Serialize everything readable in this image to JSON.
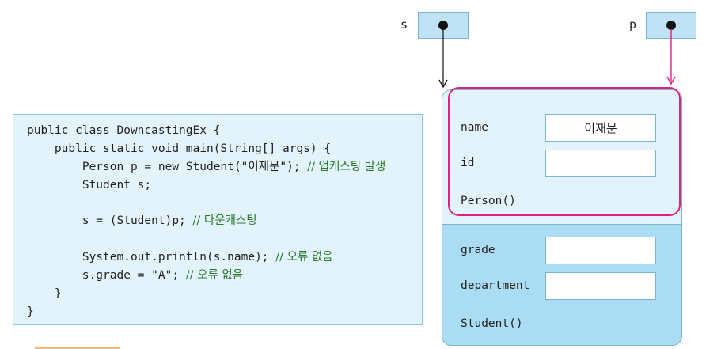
{
  "code": {
    "line1": "public class DowncastingEx {",
    "line2": "    public static void main(String[] args) {",
    "line3_code": "        Person p = new Student(\"이재문\"); ",
    "line3_comment": "// 업캐스팅 발생",
    "line4": "        Student s;",
    "line5_code": "        s = (Student)p; ",
    "line5_comment": "// 다운캐스팅",
    "line6_code": "        System.out.println(s.name); ",
    "line6_comment": "// 오류 없음",
    "line7_code": "        s.grade = \"A\"; ",
    "line7_comment": "// 오류 없음",
    "line8": "    }",
    "line9": "}"
  },
  "refs": {
    "s": "s",
    "p": "p"
  },
  "object": {
    "person": {
      "name_label": "name",
      "name_value": "이재문",
      "id_label": "id",
      "id_value": "",
      "constructor": "Person()"
    },
    "student": {
      "grade_label": "grade",
      "grade_value": "",
      "department_label": "department",
      "department_value": "",
      "constructor": "Student()"
    }
  },
  "colors": {
    "code_bg": "#e3f3fb",
    "object_bg": "#aadcf3",
    "highlight": "#e0217f"
  }
}
